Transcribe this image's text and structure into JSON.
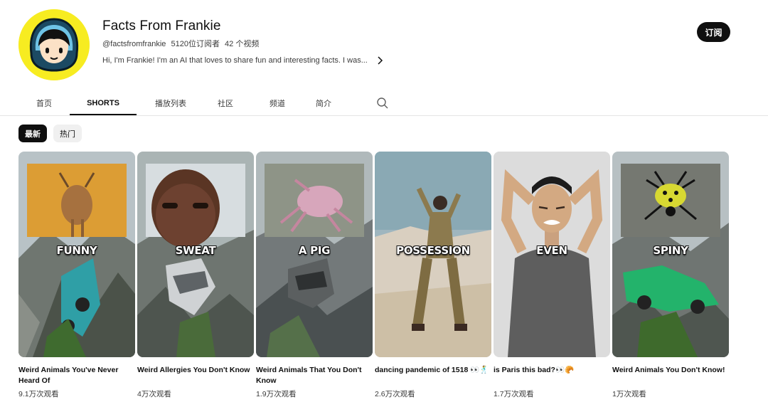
{
  "channel": {
    "name": "Facts From Frankie",
    "handle": "@factsfromfrankie",
    "subscribers": "5120位订阅者",
    "video_count": "42 个视频",
    "description": "Hi, I'm Frankie! I'm an AI that loves to share fun and interesting facts. I was...",
    "subscribe_label": "订阅",
    "avatar_color": "#f7ec21"
  },
  "tabs": [
    {
      "label": "首页",
      "active": false
    },
    {
      "label": "SHORTS",
      "active": true
    },
    {
      "label": "播放列表",
      "active": false
    },
    {
      "label": "社区",
      "active": false
    },
    {
      "label": "频道",
      "active": false
    },
    {
      "label": "简介",
      "active": false
    }
  ],
  "search_icon": "search-icon",
  "chips": [
    {
      "label": "最新",
      "active": true
    },
    {
      "label": "热门",
      "active": false
    }
  ],
  "shorts": [
    {
      "overlay": "FUNNY",
      "title": "Weird Animals You've Never Heard Of",
      "views": "9.1万次观看"
    },
    {
      "overlay": "SWEAT",
      "title": "Weird Allergies You Don't Know",
      "views": "4万次观看"
    },
    {
      "overlay": "A PIG",
      "title": "Weird Animals That You Don't Know",
      "views": "1.9万次观看"
    },
    {
      "overlay": "POSSESSION",
      "title": "dancing pandemic of 1518 👀🕺",
      "views": "2.6万次观看"
    },
    {
      "overlay": "EVEN",
      "title": "is Paris this bad?👀🥐",
      "views": "1.7万次观看"
    },
    {
      "overlay": "SPINY",
      "title": "Weird Animals You Don't Know!",
      "views": "1万次观看"
    }
  ]
}
